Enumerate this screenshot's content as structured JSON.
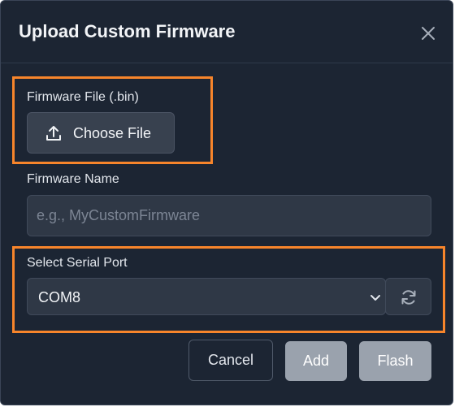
{
  "dialog": {
    "title": "Upload Custom Firmware",
    "close_icon": "close-icon"
  },
  "firmware_file": {
    "label": "Firmware File (.bin)",
    "button_label": "Choose File",
    "button_icon": "upload-icon"
  },
  "firmware_name": {
    "label": "Firmware Name",
    "value": "",
    "placeholder": "e.g., MyCustomFirmware"
  },
  "serial_port": {
    "label": "Select Serial Port",
    "selected": "COM8",
    "refresh_icon": "refresh-icon"
  },
  "footer": {
    "cancel_label": "Cancel",
    "add_label": "Add",
    "flash_label": "Flash"
  },
  "colors": {
    "background": "#1c2533",
    "highlight": "#f7852b",
    "disabled_button": "#9aa2ad"
  }
}
